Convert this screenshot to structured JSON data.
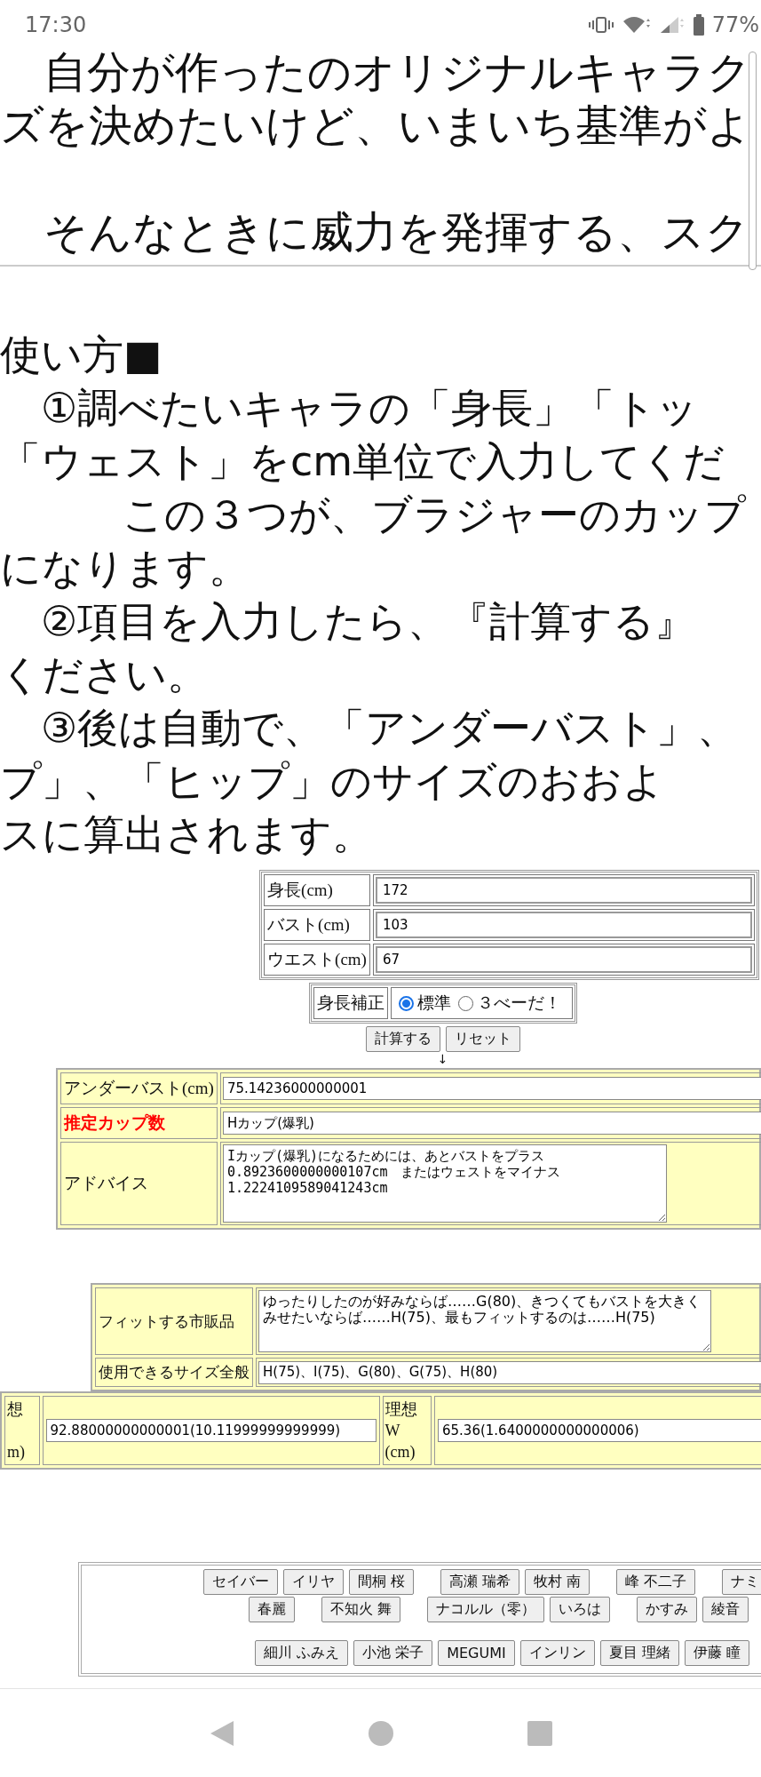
{
  "status_bar": {
    "time": "17:30",
    "battery": "77%"
  },
  "intro_lines": [
    "　自分が作ったのオリジナルキャラク",
    "ズを決めたいけど、いまいち基準がよ"
  ],
  "intro_lead": "　そんなときに威力を発揮する、スク",
  "usage_lines": [
    "使い方■",
    "　①調べたいキャラの「身長」「トッ",
    "「ウェスト」をcm単位で入力してくだ",
    "　　　この３つが、ブラジャーのカップ",
    "になります。",
    "　②項目を入力したら、『計算する』",
    "ください。",
    "　③後は自動で、「アンダーバスト」、",
    "プ」、「ヒップ」のサイズのおおよ",
    "スに算出されます。"
  ],
  "input_form": {
    "fields": [
      {
        "label": "身長(cm)",
        "value": "172"
      },
      {
        "label": "バスト(cm)",
        "value": "103"
      },
      {
        "label": "ウエスト(cm)",
        "value": "67"
      }
    ],
    "height_correction": {
      "label": "身長補正",
      "options": [
        {
          "label": "標準",
          "selected": true
        },
        {
          "label": "３べーだ！",
          "selected": false
        }
      ]
    },
    "buttons": [
      "計算する",
      "リセット"
    ],
    "arrow": "↓"
  },
  "results": [
    {
      "label": "アンダーバスト(cm)",
      "kind": "field",
      "highlighted": false,
      "value": "75.14236000000001"
    },
    {
      "label": "推定カップ数",
      "kind": "field",
      "highlighted": true,
      "value": "Hカップ(爆乳)"
    },
    {
      "label": "アドバイス",
      "kind": "textarea",
      "highlighted": false,
      "value": "Iカップ(爆乳)になるためには、あとバストをプラス\n0.8923600000000107cm　またはウェストをマイナス\n1.2224109589041243cm"
    }
  ],
  "fit_results": [
    {
      "label": "フィットする市販品",
      "kind": "textarea",
      "value": "ゆったりしたのが好みならば……G(80)、きつくてもバストを大きくみせたいならば……H(75)、最もフィットするのは……H(75)"
    },
    {
      "label": "使用できるサイズ全般",
      "kind": "field",
      "value": "H(75)、I(75)、G(80)、G(75)、H(80)"
    }
  ],
  "ideal": [
    {
      "label_lines": [
        "想",
        "m)"
      ],
      "value": "92.88000000000001(10.11999999999999)"
    },
    {
      "label_lines": [
        "理想",
        "W",
        "(cm)"
      ],
      "value": "65.36(1.6400000000000006)"
    }
  ],
  "character_buttons": [
    [
      "セイバー",
      "イリヤ",
      "間桐 桜",
      "高瀬 瑞希",
      "牧村 南",
      "峰 不二子",
      "ナミ"
    ],
    [
      "春麗",
      "不知火 舞",
      "ナコルル（零）",
      "いろは",
      "かすみ",
      "綾音"
    ],
    [
      "細川 ふみえ",
      "小池 栄子",
      "MEGUMI",
      "インリン",
      "夏目 理緒",
      "伊藤 瞳"
    ]
  ]
}
